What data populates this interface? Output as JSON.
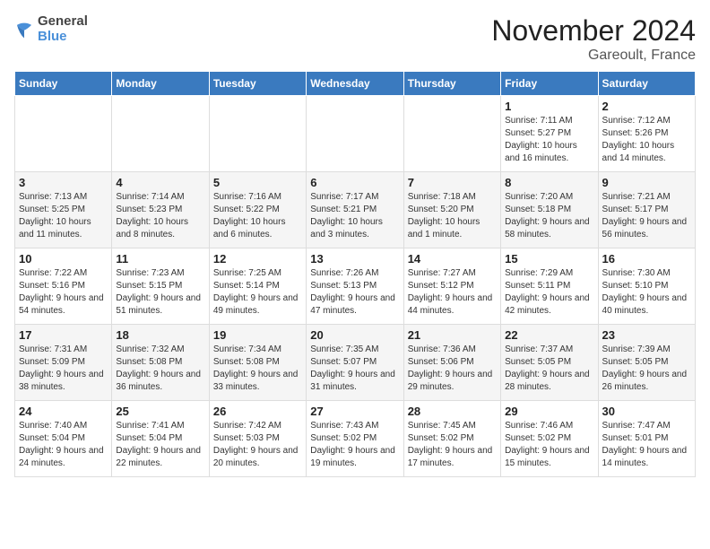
{
  "logo": {
    "line1": "General",
    "line2": "Blue"
  },
  "title": "November 2024",
  "subtitle": "Gareoult, France",
  "days_of_week": [
    "Sunday",
    "Monday",
    "Tuesday",
    "Wednesday",
    "Thursday",
    "Friday",
    "Saturday"
  ],
  "weeks": [
    [
      {
        "day": "",
        "content": ""
      },
      {
        "day": "",
        "content": ""
      },
      {
        "day": "",
        "content": ""
      },
      {
        "day": "",
        "content": ""
      },
      {
        "day": "",
        "content": ""
      },
      {
        "day": "1",
        "content": "Sunrise: 7:11 AM\nSunset: 5:27 PM\nDaylight: 10 hours and 16 minutes."
      },
      {
        "day": "2",
        "content": "Sunrise: 7:12 AM\nSunset: 5:26 PM\nDaylight: 10 hours and 14 minutes."
      }
    ],
    [
      {
        "day": "3",
        "content": "Sunrise: 7:13 AM\nSunset: 5:25 PM\nDaylight: 10 hours and 11 minutes."
      },
      {
        "day": "4",
        "content": "Sunrise: 7:14 AM\nSunset: 5:23 PM\nDaylight: 10 hours and 8 minutes."
      },
      {
        "day": "5",
        "content": "Sunrise: 7:16 AM\nSunset: 5:22 PM\nDaylight: 10 hours and 6 minutes."
      },
      {
        "day": "6",
        "content": "Sunrise: 7:17 AM\nSunset: 5:21 PM\nDaylight: 10 hours and 3 minutes."
      },
      {
        "day": "7",
        "content": "Sunrise: 7:18 AM\nSunset: 5:20 PM\nDaylight: 10 hours and 1 minute."
      },
      {
        "day": "8",
        "content": "Sunrise: 7:20 AM\nSunset: 5:18 PM\nDaylight: 9 hours and 58 minutes."
      },
      {
        "day": "9",
        "content": "Sunrise: 7:21 AM\nSunset: 5:17 PM\nDaylight: 9 hours and 56 minutes."
      }
    ],
    [
      {
        "day": "10",
        "content": "Sunrise: 7:22 AM\nSunset: 5:16 PM\nDaylight: 9 hours and 54 minutes."
      },
      {
        "day": "11",
        "content": "Sunrise: 7:23 AM\nSunset: 5:15 PM\nDaylight: 9 hours and 51 minutes."
      },
      {
        "day": "12",
        "content": "Sunrise: 7:25 AM\nSunset: 5:14 PM\nDaylight: 9 hours and 49 minutes."
      },
      {
        "day": "13",
        "content": "Sunrise: 7:26 AM\nSunset: 5:13 PM\nDaylight: 9 hours and 47 minutes."
      },
      {
        "day": "14",
        "content": "Sunrise: 7:27 AM\nSunset: 5:12 PM\nDaylight: 9 hours and 44 minutes."
      },
      {
        "day": "15",
        "content": "Sunrise: 7:29 AM\nSunset: 5:11 PM\nDaylight: 9 hours and 42 minutes."
      },
      {
        "day": "16",
        "content": "Sunrise: 7:30 AM\nSunset: 5:10 PM\nDaylight: 9 hours and 40 minutes."
      }
    ],
    [
      {
        "day": "17",
        "content": "Sunrise: 7:31 AM\nSunset: 5:09 PM\nDaylight: 9 hours and 38 minutes."
      },
      {
        "day": "18",
        "content": "Sunrise: 7:32 AM\nSunset: 5:08 PM\nDaylight: 9 hours and 36 minutes."
      },
      {
        "day": "19",
        "content": "Sunrise: 7:34 AM\nSunset: 5:08 PM\nDaylight: 9 hours and 33 minutes."
      },
      {
        "day": "20",
        "content": "Sunrise: 7:35 AM\nSunset: 5:07 PM\nDaylight: 9 hours and 31 minutes."
      },
      {
        "day": "21",
        "content": "Sunrise: 7:36 AM\nSunset: 5:06 PM\nDaylight: 9 hours and 29 minutes."
      },
      {
        "day": "22",
        "content": "Sunrise: 7:37 AM\nSunset: 5:05 PM\nDaylight: 9 hours and 28 minutes."
      },
      {
        "day": "23",
        "content": "Sunrise: 7:39 AM\nSunset: 5:05 PM\nDaylight: 9 hours and 26 minutes."
      }
    ],
    [
      {
        "day": "24",
        "content": "Sunrise: 7:40 AM\nSunset: 5:04 PM\nDaylight: 9 hours and 24 minutes."
      },
      {
        "day": "25",
        "content": "Sunrise: 7:41 AM\nSunset: 5:04 PM\nDaylight: 9 hours and 22 minutes."
      },
      {
        "day": "26",
        "content": "Sunrise: 7:42 AM\nSunset: 5:03 PM\nDaylight: 9 hours and 20 minutes."
      },
      {
        "day": "27",
        "content": "Sunrise: 7:43 AM\nSunset: 5:02 PM\nDaylight: 9 hours and 19 minutes."
      },
      {
        "day": "28",
        "content": "Sunrise: 7:45 AM\nSunset: 5:02 PM\nDaylight: 9 hours and 17 minutes."
      },
      {
        "day": "29",
        "content": "Sunrise: 7:46 AM\nSunset: 5:02 PM\nDaylight: 9 hours and 15 minutes."
      },
      {
        "day": "30",
        "content": "Sunrise: 7:47 AM\nSunset: 5:01 PM\nDaylight: 9 hours and 14 minutes."
      }
    ]
  ]
}
